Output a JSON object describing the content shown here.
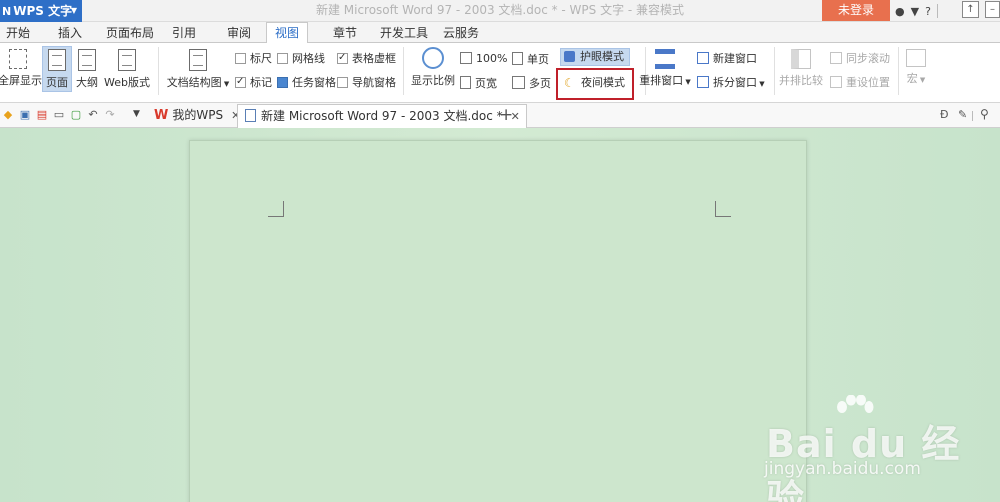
{
  "titlebar": {
    "app_name": "WPS 文字",
    "window_title": "新建 Microsoft Word 97 - 2003 文档.doc * - WPS 文字 - 兼容模式",
    "login_label": "未登录",
    "help_label": "?"
  },
  "tabs": [
    "开始",
    "插入",
    "页面布局",
    "引用",
    "审阅",
    "视图",
    "章节",
    "开发工具",
    "云服务"
  ],
  "active_tab": "视图",
  "ribbon": {
    "fullscreen": "全屏显示",
    "page": "页面",
    "outline": "大纲",
    "web": "Web版式",
    "doc_structure": "文档结构图",
    "ruler": "标尺",
    "gridlines": "网格线",
    "table_borders": "表格虚框",
    "marks": "标记",
    "task_pane": "任务窗格",
    "nav_pane": "导航窗格",
    "zoom": "显示比例",
    "zoom_100": "100%",
    "page_width": "页宽",
    "single_page": "单页",
    "multi_page": "多页",
    "eye_mode": "护眼模式",
    "night_mode": "夜间模式",
    "rearrange": "重排窗口",
    "new_window": "新建窗口",
    "split_window": "拆分窗口",
    "side_by_side": "并排比较",
    "sync_scroll": "同步滚动",
    "reset_position": "重设位置",
    "macro": "宏"
  },
  "checkboxes": {
    "ruler": false,
    "gridlines": false,
    "table_borders": true,
    "marks": true,
    "task_pane": true,
    "nav_pane": false
  },
  "doc_tabs": {
    "home": "我的WPS",
    "document": "新建 Microsoft Word 97 - 2003 文档.doc *",
    "add": "+"
  },
  "watermark": {
    "brand": "Bai du 经验",
    "url": "jingyan.baidu.com"
  },
  "colors": {
    "accent": "#2e6fc7",
    "login": "#e8704e",
    "eye_mode_bg": "#c6d9ef",
    "highlight_box": "#c0202a",
    "page_bg": "#cde6cd"
  }
}
